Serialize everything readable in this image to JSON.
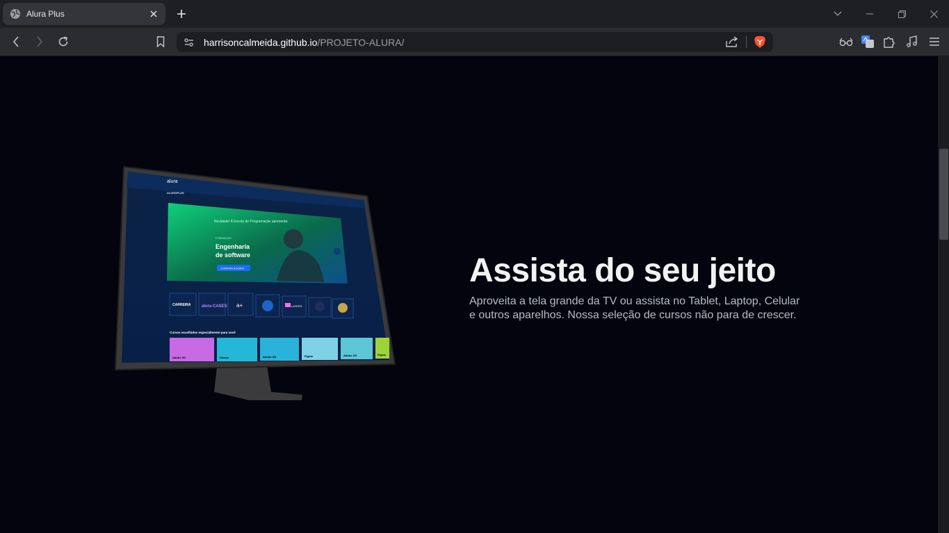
{
  "browser": {
    "tab_title": "Alura Plus",
    "url_host": "harrisoncalmeida.github.io",
    "url_path": "/PROJETO-ALURA/"
  },
  "hero": {
    "headline": "Assista do seu jeito",
    "subtitle_line1": "Aproveita a tela grande da TV ou assista no Tablet, Laptop, Celular",
    "subtitle_line2": "e outros aparelhos. Nossa seleção de cursos não para de crescer."
  },
  "screen": {
    "logo": "alura",
    "brand": "ALURAPLUS",
    "banner_intro": "Novidade! A Escola de Programação apresenta:",
    "banner_formacao": "FORMAÇÃO",
    "banner_title_1": "Engenharia",
    "banner_title_2": "de software",
    "banner_cta": "CONFIRA AGORA!",
    "tiles": [
      "CARREIRA",
      "alura CASES",
      "a+",
      "",
      "LAYERS",
      "",
      ""
    ],
    "courses_heading": "Cursos escolhidos especialmente para você",
    "courses": [
      "Adobe XD",
      "Sketch",
      "Adobe XD",
      "Figma",
      "Adobe XD",
      "Figma"
    ]
  },
  "colors": {
    "page_bg": "#03040d",
    "chrome_bg": "#1e1f22",
    "toolbar_bg": "#2b2c30",
    "brave_orange": "#fb542b"
  }
}
